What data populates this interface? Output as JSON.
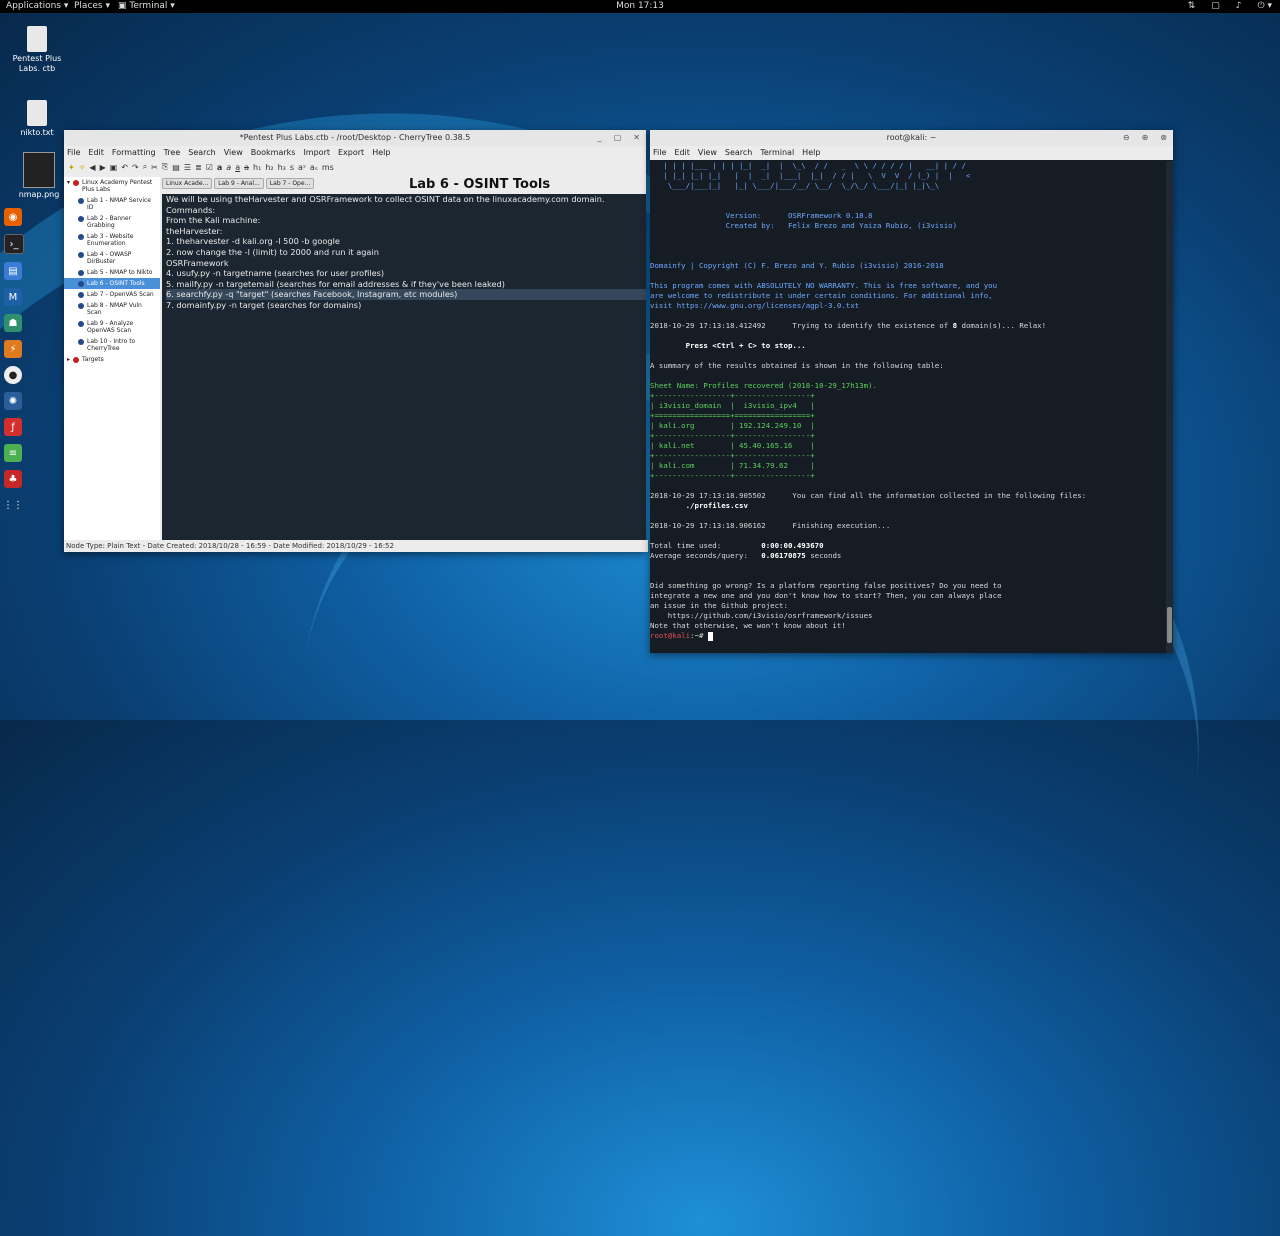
{
  "topbar": {
    "applications": "Applications",
    "places": "Places",
    "terminal": "Terminal",
    "clock": "Mon 17:13"
  },
  "desktop": {
    "icons": [
      {
        "label": "Pentest Plus Labs. ctb"
      },
      {
        "label": "nikto.txt"
      },
      {
        "label": "nmap.png"
      }
    ]
  },
  "dock": {
    "items": [
      "firefox-icon",
      "terminal-icon",
      "files-icon",
      "metasploit-icon",
      "armitage-icon",
      "burpsuite-icon",
      "maltego-icon",
      "beef-icon",
      "faraday-icon",
      "leafpad-icon",
      "cherrytree-icon",
      "show-apps-icon"
    ]
  },
  "cherrytree": {
    "title": "*Pentest Plus Labs.ctb - /root/Desktop - CherryTree 0.38.5",
    "menu": [
      "File",
      "Edit",
      "Formatting",
      "Tree",
      "Search",
      "View",
      "Bookmarks",
      "Import",
      "Export",
      "Help"
    ],
    "tree": [
      {
        "label": "Linux Academy Pentest Plus Labs",
        "root": true
      },
      {
        "label": "Lab 1 - NMAP Service ID"
      },
      {
        "label": "Lab 2 - Banner Grabbing"
      },
      {
        "label": "Lab 3 - Website Enumeration"
      },
      {
        "label": "Lab 4 - OWASP DirBuster"
      },
      {
        "label": "Lab 5 - NMAP to Nikto"
      },
      {
        "label": "Lab 6 - OSINT Tools",
        "selected": true
      },
      {
        "label": "Lab 7 - OpenVAS Scan"
      },
      {
        "label": "Lab 8 - NMAP Vuln Scan"
      },
      {
        "label": "Lab 9 - Analyze OpenVAS Scan"
      },
      {
        "label": "Lab 10 - Intro to CherryTree"
      },
      {
        "label": "Targets",
        "root": true
      }
    ],
    "tabs": [
      "Linux Acade...",
      "Lab 9 - Anal...",
      "Lab 7 - Ope..."
    ],
    "node_title": "Lab 6 - OSINT Tools",
    "editor_lines": [
      "We will be using theHarvester and OSRFramework to collect OSINT data on the linuxacademy.com domain.",
      "",
      "Commands:",
      "",
      "From the Kali machine:",
      "",
      "theHarvester:",
      "1. theharvester -d kali.org -l 500 -b google",
      "2. now change the -l (limit) to 2000 and run it again",
      "",
      "OSRFramework",
      "4. usufy.py -n targetname (searches for user profiles)",
      "5. mailfy.py -n targetemail (searches for email addresses & if they've been leaked)",
      "6. searchfy.py -q \"target\" (searches Facebook, Instagram, etc modules)",
      "7. domainfy.py -n target (searches for domains)"
    ],
    "highlight_line": 13,
    "statusbar": "Node Type: Plain Text  -  Date Created: 2018/10/28 - 16:59  -  Date Modified: 2018/10/29 - 16:52"
  },
  "terminal": {
    "title": "root@kali: ~",
    "menu": [
      "File",
      "Edit",
      "View",
      "Search",
      "Terminal",
      "Help"
    ],
    "version_label": "Version:",
    "version_value": "OSRFramework 0.18.8",
    "created_label": "Created by:",
    "created_value": "Felix Brezo and Yaiza Rubio, (i3visio)",
    "copyright": "Domainfy | Copyright (C) F. Brezo and Y. Rubio (i3visio) 2016-2018",
    "license_1": "This program comes with ABSOLUTELY NO WARRANTY. This is free software, and you",
    "license_2": "are welcome to redistribute it under certain conditions. For additional info,",
    "license_3": "visit https://www.gnu.org/licenses/agpl-3.0.txt",
    "trying_time": "2018-10-29 17:13:18.412492",
    "trying_pre": "Trying to identify the existence of ",
    "trying_count": "8",
    "trying_post": " domain(s)... Relax!",
    "press": "Press <Ctrl + C> to stop...",
    "summary": "A summary of the results obtained is shown in the following table:",
    "sheet": "Sheet Name: Profiles recovered (2018-10-29_17h13m).",
    "table_sep": "+-----------------+-----------------+",
    "table_sep_eq": "+=================+=================+",
    "table_header": "| i3visio_domain  |  i3visio_ipv4   |",
    "rows": [
      "| kali.org        | 192.124.249.10  |",
      "| kali.net        | 45.40.165.16    |",
      "| kali.com        | 71.34.79.62     |"
    ],
    "found_time": "2018-10-29 17:13:18.905502",
    "found_text": "You can find all the information collected in the following files:",
    "found_file": "        ./profiles.csv",
    "finish_time": "2018-10-29 17:13:18.906162",
    "finish_text": "Finishing execution...",
    "total_label": "Total time used:",
    "total_value": "0:00:00.493670",
    "avg_label": "Average seconds/query:",
    "avg_value": "0.06170875",
    "avg_unit": " seconds",
    "wrong_1": "Did something go wrong? Is a platform reporting false positives? Do you need to",
    "wrong_2": "integrate a new one and you don't know how to start? Then, you can always place",
    "wrong_3": "an issue in the Github project:",
    "wrong_4": "    https://github.com/i3visio/osrframework/issues",
    "wrong_5": "Note that otherwise, we won't know about it!",
    "prompt_user": "root@kali",
    "prompt_rest": ":~# "
  }
}
